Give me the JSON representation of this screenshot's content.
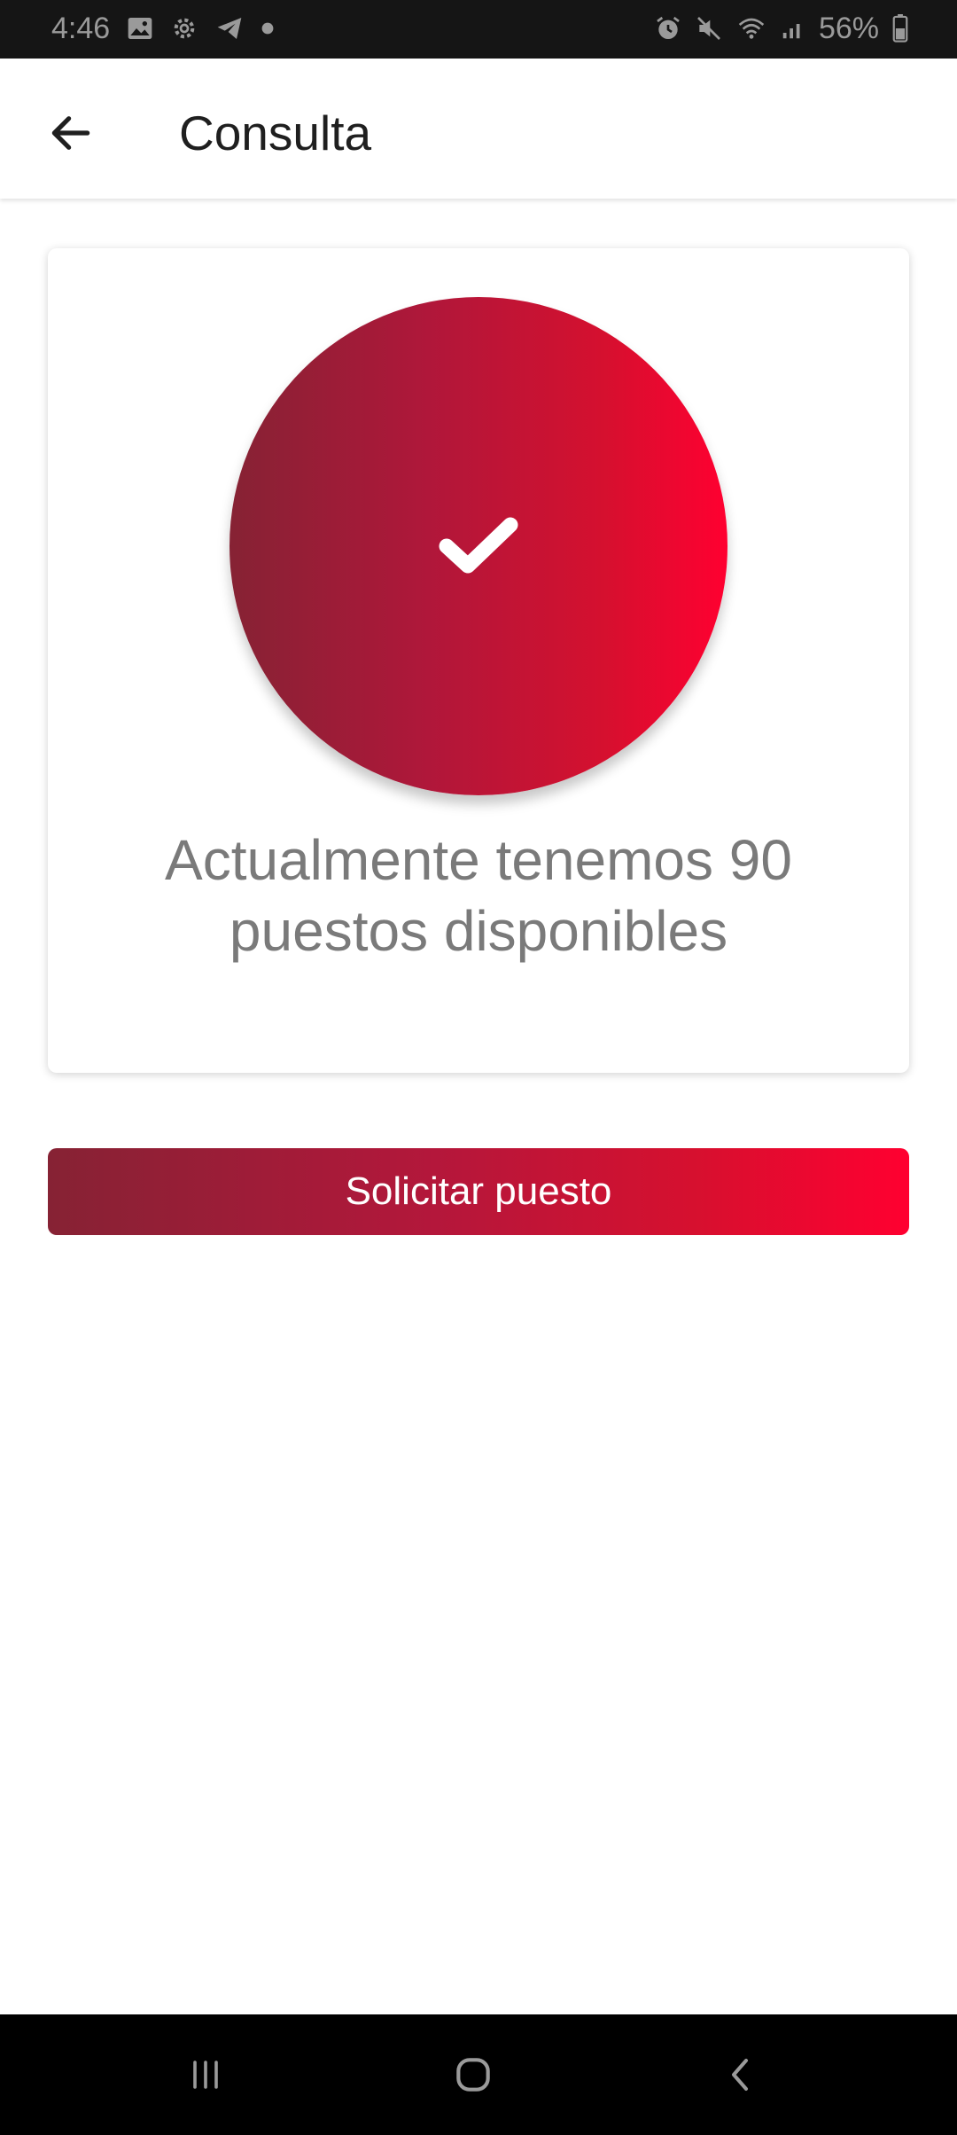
{
  "status_bar": {
    "time": "4:46",
    "battery": "56%",
    "left_icons": [
      "gallery-icon",
      "settings-icon",
      "telegram-icon",
      "dot-icon"
    ],
    "right_icons": [
      "alarm-icon",
      "mute-icon",
      "wifi-icon",
      "signal-icon",
      "battery-icon"
    ]
  },
  "app_bar": {
    "title": "Consulta",
    "back_icon": "arrow-left-icon"
  },
  "card": {
    "status_icon": "check-icon",
    "message": "Actualmente tenemos 90 puestos disponibles"
  },
  "actions": {
    "request_label": "Solicitar puesto"
  },
  "nav_bar": {
    "icons": [
      "recent-apps-icon",
      "home-icon",
      "back-icon"
    ]
  },
  "colors": {
    "gradient_start": "#862234",
    "gradient_end": "#ff0030",
    "message_text": "#7a7a7a",
    "title_text": "#1f1f1f"
  }
}
